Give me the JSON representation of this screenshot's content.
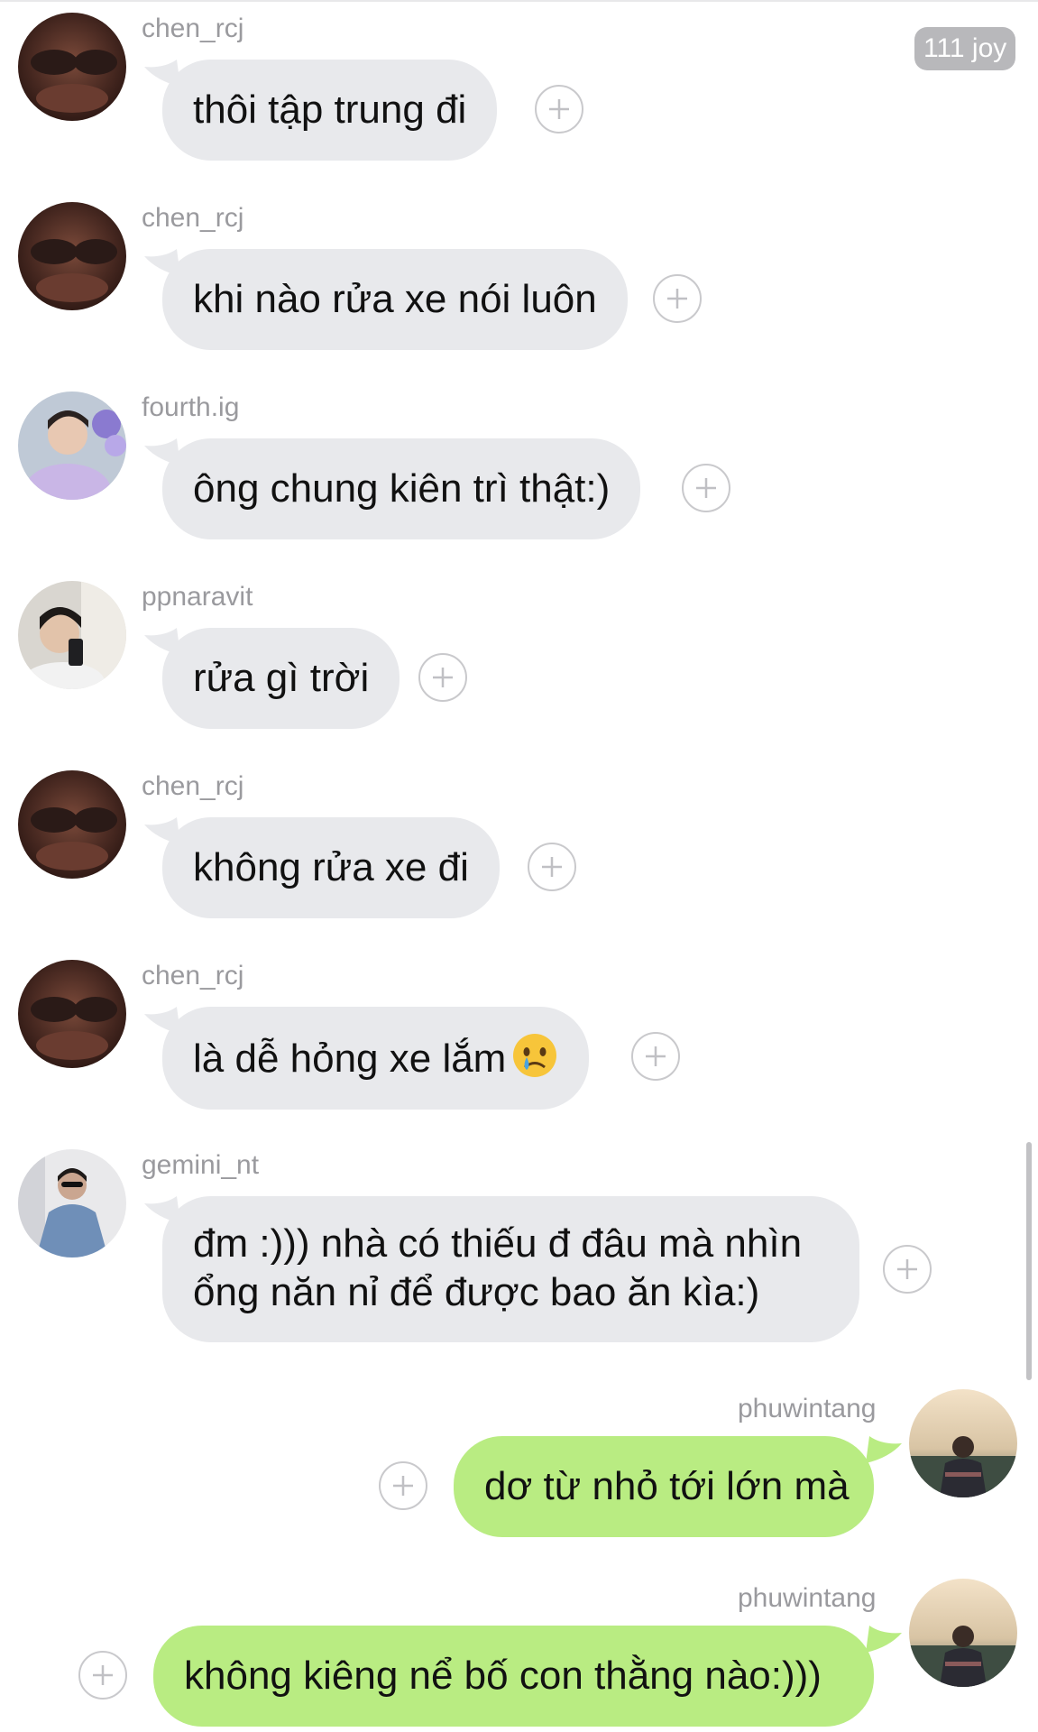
{
  "badge_text": "111 joy",
  "messages": [
    {
      "user": "chen_rcj",
      "text": "thôi tập trung đi",
      "side": "in",
      "avatar_icon": "avatar-chen-icon"
    },
    {
      "user": "chen_rcj",
      "text": "khi nào rửa xe nói luôn",
      "side": "in",
      "avatar_icon": "avatar-chen-icon"
    },
    {
      "user": "fourth.ig",
      "text": "ông chung kiên trì thật:)",
      "side": "in",
      "avatar_icon": "avatar-fourth-icon"
    },
    {
      "user": "ppnaravit",
      "text": "rửa gì trời",
      "side": "in",
      "avatar_icon": "avatar-ppnaravit-icon"
    },
    {
      "user": "chen_rcj",
      "text": "không rửa xe đi",
      "side": "in",
      "avatar_icon": "avatar-chen-icon"
    },
    {
      "user": "chen_rcj",
      "text": "là dễ hỏng xe lắm",
      "side": "in",
      "avatar_icon": "avatar-chen-icon",
      "emoji": "crying-face-emoji"
    },
    {
      "user": "gemini_nt",
      "text": "đm :))) nhà có thiếu đ đâu mà nhìn ổng năn nỉ để được bao ăn kìa:)",
      "side": "in",
      "avatar_icon": "avatar-gemini-icon"
    },
    {
      "user": "phuwintang",
      "text": "dơ từ nhỏ tới lớn mà",
      "side": "out",
      "avatar_icon": "avatar-phuwintang-icon"
    },
    {
      "user": "phuwintang",
      "text": "không kiêng nể bố con thằng nào:)))",
      "side": "out",
      "avatar_icon": "avatar-phuwintang-icon"
    }
  ],
  "colors": {
    "incoming_bubble": "#e8e9ec",
    "outgoing_bubble": "#b9ec82",
    "username": "#9a9a9e",
    "badge": "#b8b8bb"
  },
  "icons": {
    "react": "plus-circle-icon"
  }
}
